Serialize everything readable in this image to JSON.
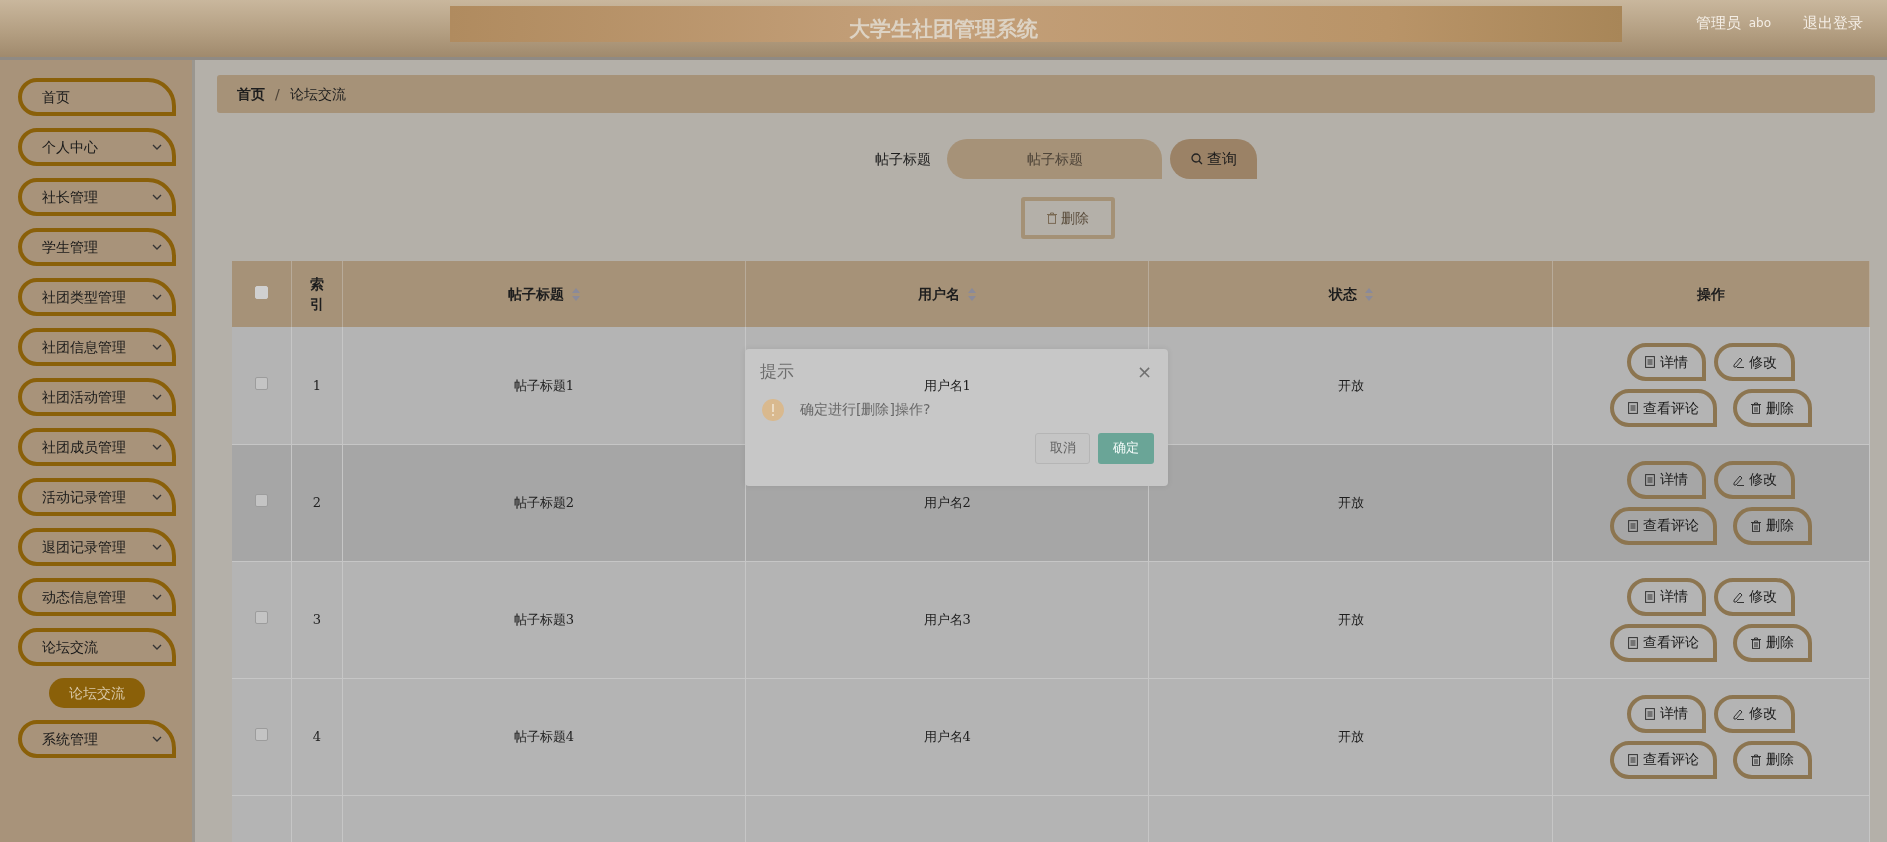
{
  "header": {
    "title": "大学生社团管理系统",
    "user_role": "管理员",
    "user_name": "abo",
    "logout": "退出登录"
  },
  "sidebar": {
    "items": [
      {
        "label": "首页",
        "kind": "link"
      },
      {
        "label": "个人中心",
        "kind": "menu"
      },
      {
        "label": "社长管理",
        "kind": "menu"
      },
      {
        "label": "学生管理",
        "kind": "menu"
      },
      {
        "label": "社团类型管理",
        "kind": "menu"
      },
      {
        "label": "社团信息管理",
        "kind": "menu"
      },
      {
        "label": "社团活动管理",
        "kind": "menu"
      },
      {
        "label": "社团成员管理",
        "kind": "menu"
      },
      {
        "label": "活动记录管理",
        "kind": "menu"
      },
      {
        "label": "退团记录管理",
        "kind": "menu"
      },
      {
        "label": "动态信息管理",
        "kind": "menu"
      },
      {
        "label": "论坛交流",
        "kind": "menu",
        "children": [
          {
            "label": "论坛交流",
            "selected": true
          }
        ]
      },
      {
        "label": "系统管理",
        "kind": "menu"
      }
    ]
  },
  "breadcrumb": {
    "separator": "/",
    "items": [
      {
        "label": "首页"
      },
      {
        "label": "论坛交流"
      }
    ]
  },
  "search": {
    "label": "帖子标题",
    "placeholder": "帖子标题",
    "button": "查询"
  },
  "delete_button": {
    "label": "删除",
    "disabled": true
  },
  "table": {
    "select_all_checked": false,
    "columns": [
      {
        "label": "索引",
        "sortable": false
      },
      {
        "label": "帖子标题",
        "sortable": true
      },
      {
        "label": "用户名",
        "sortable": true
      },
      {
        "label": "状态",
        "sortable": true
      },
      {
        "label": "操作",
        "sortable": false
      }
    ],
    "rows": [
      {
        "index": "1",
        "title": "帖子标题1",
        "username": "用户名1",
        "status": "开放",
        "checked": false,
        "highlighted": false,
        "actions": [
          {
            "label": "详情",
            "kind": "detail"
          },
          {
            "label": "修改",
            "kind": "edit"
          },
          {
            "label": "查看评论",
            "kind": "comments"
          },
          {
            "label": "删除",
            "kind": "delete"
          }
        ]
      },
      {
        "index": "2",
        "title": "帖子标题2",
        "username": "用户名2",
        "status": "开放",
        "checked": false,
        "highlighted": true,
        "actions": [
          {
            "label": "详情",
            "kind": "detail"
          },
          {
            "label": "修改",
            "kind": "edit"
          },
          {
            "label": "查看评论",
            "kind": "comments"
          },
          {
            "label": "删除",
            "kind": "delete"
          }
        ]
      },
      {
        "index": "3",
        "title": "帖子标题3",
        "username": "用户名3",
        "status": "开放",
        "checked": false,
        "highlighted": false,
        "actions": [
          {
            "label": "详情",
            "kind": "detail"
          },
          {
            "label": "修改",
            "kind": "edit"
          },
          {
            "label": "查看评论",
            "kind": "comments"
          },
          {
            "label": "删除",
            "kind": "delete"
          }
        ]
      },
      {
        "index": "4",
        "title": "帖子标题4",
        "username": "用户名4",
        "status": "开放",
        "checked": false,
        "highlighted": false,
        "actions": [
          {
            "label": "详情",
            "kind": "detail"
          },
          {
            "label": "修改",
            "kind": "edit"
          },
          {
            "label": "查看评论",
            "kind": "comments"
          },
          {
            "label": "删除",
            "kind": "delete"
          }
        ]
      }
    ]
  },
  "dialog": {
    "title": "提示",
    "close": "×",
    "message": "确定进行[删除]操作?",
    "buttons": [
      {
        "label": "取消",
        "kind": "cancel"
      },
      {
        "label": "确定",
        "kind": "confirm"
      }
    ]
  }
}
